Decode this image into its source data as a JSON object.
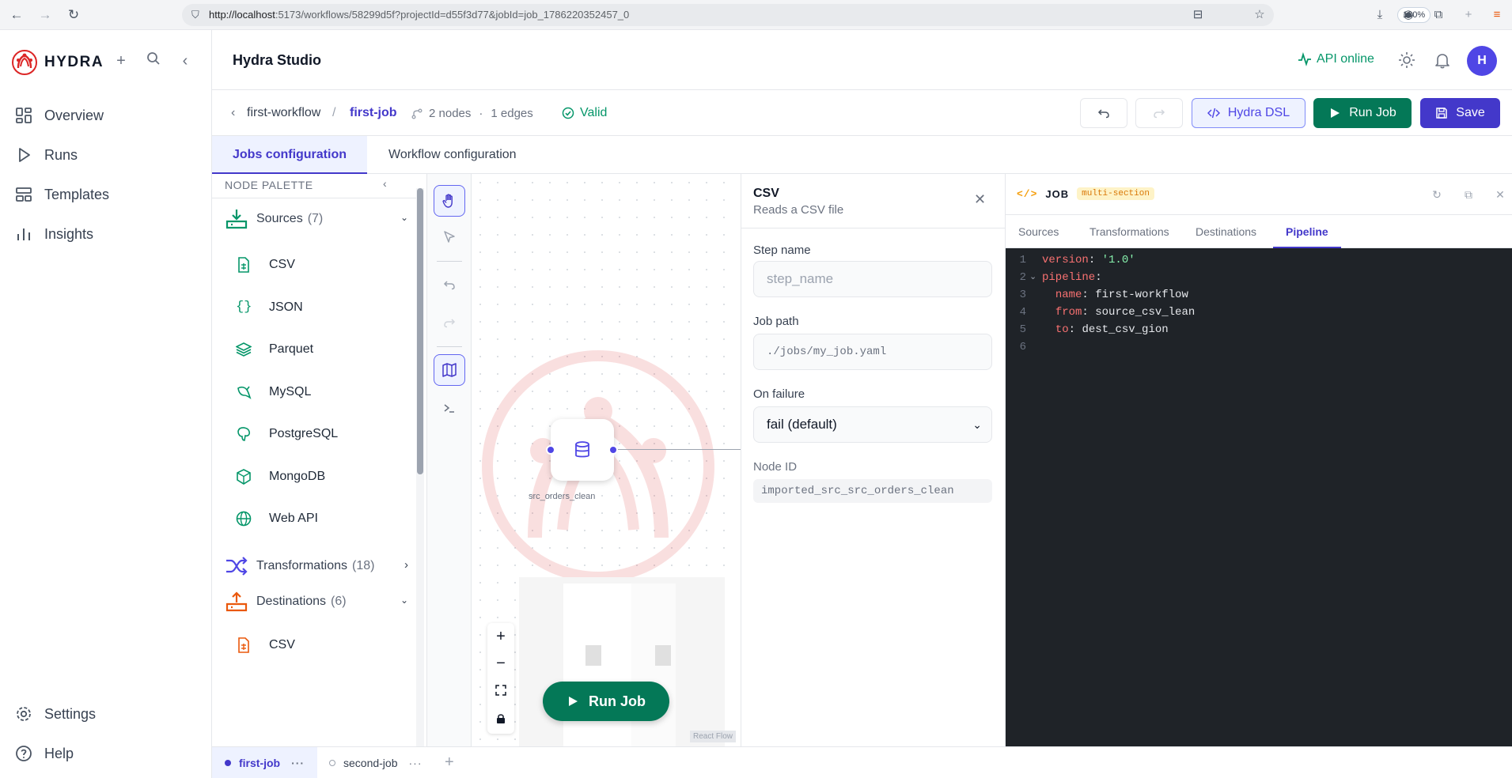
{
  "browser": {
    "url_host": "http://localhost",
    "url_rest": ":5173/workflows/58299d5f?projectId=d55f3d77&jobId=job_1786220352457_0",
    "zoom": "130%"
  },
  "sidebar": {
    "brand": "HYDRA",
    "items": [
      {
        "label": "Overview",
        "icon": "dashboard-icon"
      },
      {
        "label": "Runs",
        "icon": "play-icon"
      },
      {
        "label": "Templates",
        "icon": "layout-icon"
      },
      {
        "label": "Insights",
        "icon": "bar-chart-icon"
      }
    ],
    "footer": [
      {
        "label": "Settings",
        "icon": "gear-icon"
      },
      {
        "label": "Help",
        "icon": "help-icon"
      }
    ]
  },
  "header": {
    "title": "Hydra Studio",
    "api_status": "API online",
    "avatar_initial": "H"
  },
  "toolbar": {
    "crumb_parent": "first-workflow",
    "crumb_sep": "/",
    "crumb_current": "first-job",
    "nodes": "2 nodes",
    "dot": "·",
    "edges": "1 edges",
    "status": "Valid",
    "dsl_label": "Hydra DSL",
    "run_label": "Run Job",
    "save_label": "Save"
  },
  "tabs": {
    "jobs": "Jobs configuration",
    "workflow": "Workflow configuration"
  },
  "palette": {
    "heading": "NODE PALETTE",
    "sources": {
      "label": "Sources",
      "count": "(7)"
    },
    "source_items": [
      "CSV",
      "JSON",
      "Parquet",
      "MySQL",
      "PostgreSQL",
      "MongoDB",
      "Web API"
    ],
    "transformations": {
      "label": "Transformations",
      "count": "(18)"
    },
    "destinations": {
      "label": "Destinations",
      "count": "(6)"
    },
    "destination_items": [
      "CSV"
    ]
  },
  "canvas": {
    "node_label": "src_orders_clean",
    "run_label": "Run Job",
    "attribution": "React Flow"
  },
  "props": {
    "title": "CSV",
    "subtitle": "Reads a CSV file",
    "step_name_label": "Step name",
    "step_name_placeholder": "step_name",
    "job_path_label": "Job path",
    "job_path_placeholder": "./jobs/my_job.yaml",
    "on_failure_label": "On failure",
    "on_failure_value": "fail (default)",
    "node_id_label": "Node ID",
    "node_id_value": "imported_src_src_orders_clean"
  },
  "code": {
    "icon": "</>",
    "title": "JOB",
    "badge": "multi-section",
    "tabs": [
      "Sources",
      "Transformations",
      "Destinations",
      "Pipeline"
    ],
    "active_tab": "Pipeline",
    "lines": [
      {
        "n": "1",
        "key": "version",
        "val": "'1.0'",
        "indent": ""
      },
      {
        "n": "2",
        "key": "pipeline",
        "val": "",
        "indent": ""
      },
      {
        "n": "3",
        "key": "name",
        "val": "first-workflow",
        "indent": "  "
      },
      {
        "n": "4",
        "key": "from",
        "val": "source_csv_lean",
        "indent": "  "
      },
      {
        "n": "5",
        "key": "to",
        "val": "dest_csv_gion",
        "indent": "  "
      },
      {
        "n": "6",
        "key": "",
        "val": "",
        "indent": ""
      }
    ]
  },
  "jobs": {
    "tabs": [
      "first-job",
      "second-job"
    ],
    "more": "···"
  },
  "colors": {
    "accent": "#4338ca",
    "success": "#047857",
    "editor_bg": "#1f2328"
  }
}
